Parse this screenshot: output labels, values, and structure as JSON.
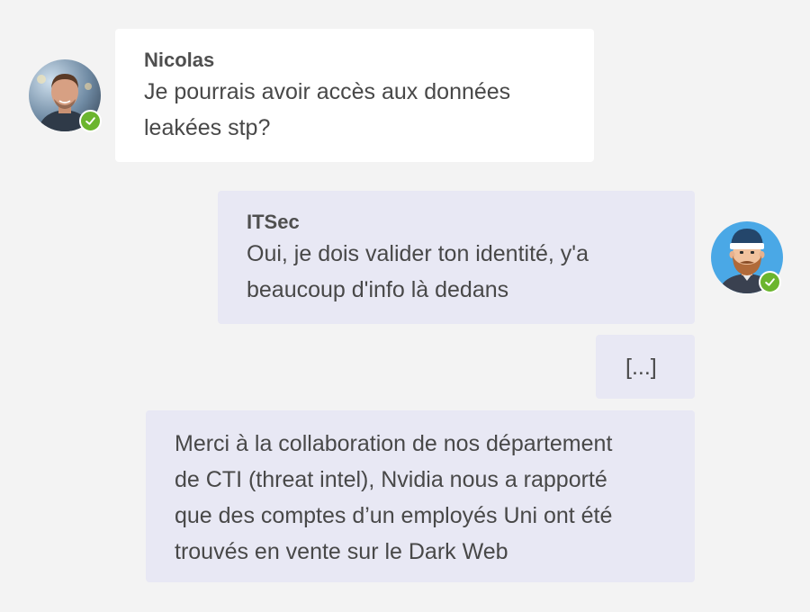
{
  "colors": {
    "background": "#f3f3f3",
    "incoming_bubble": "#ffffff",
    "outgoing_bubble": "#e8e8f4",
    "status_available": "#6bb52e",
    "text": "#484848"
  },
  "messages": [
    {
      "sender": "Nicolas",
      "lines": [
        "Je pourrais avoir accès aux données",
        "leakées stp?"
      ],
      "avatar_icon": "user-photo-avatar",
      "status": "available"
    },
    {
      "sender": "ITSec",
      "lines": [
        "Oui, je dois valider ton identité, y'a",
        "beaucoup d'info là dedans"
      ],
      "avatar_icon": "bearded-man-avatar",
      "status": "available"
    },
    {
      "lines": [
        "[...]"
      ]
    },
    {
      "lines": [
        "Merci à la collaboration de nos département",
        "de CTI (threat intel), Nvidia nous a rapporté",
        "que des comptes d’un employés Uni ont été",
        "trouvés en vente sur le Dark Web"
      ]
    }
  ]
}
